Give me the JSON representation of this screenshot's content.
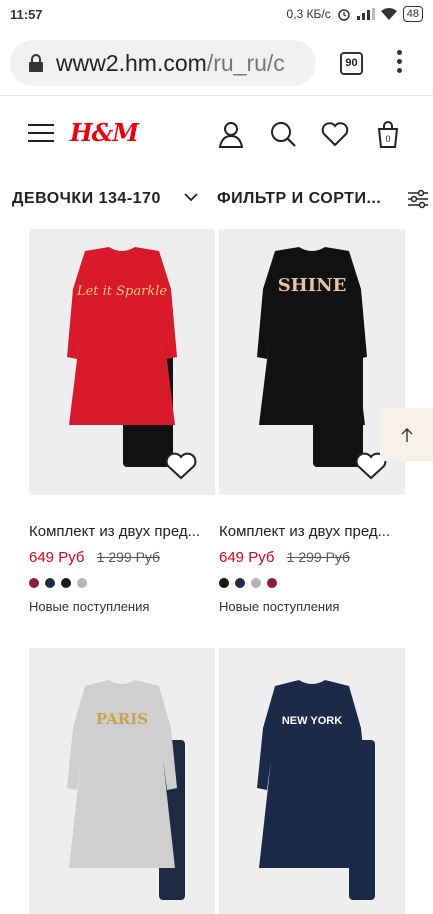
{
  "status_bar": {
    "time": "11:57",
    "net_speed": "0,3 КБ/с",
    "battery": "48"
  },
  "browser": {
    "url_host": "www2.hm.com",
    "url_path": "/ru_ru/c",
    "tab_count": "90"
  },
  "header": {
    "logo": "H&M"
  },
  "filters": {
    "category": "ДЕВОЧКИ 134-170",
    "filter_label": "ФИЛЬТР И СОРТИ..."
  },
  "products": [
    {
      "title": "Комплект из двух пред...",
      "price_new": "649 Руб",
      "price_old": "1 299 Руб",
      "swatches": [
        "#8b1e3f",
        "#1f2a44",
        "#1a1a1a",
        "#b5b5b5"
      ],
      "tag": "Новые поступления",
      "top_color": "#d81a2b",
      "top_text": "Let it Sparkle",
      "bottom_color": "#111111",
      "print_color": "#e8c77a"
    },
    {
      "title": "Комплект из двух пред...",
      "price_new": "649 Руб",
      "price_old": "1 299 Руб",
      "swatches": [
        "#1a1a1a",
        "#1f2a44",
        "#b5b5b5",
        "#8b1e3f"
      ],
      "tag": "Новые поступления",
      "top_color": "#111111",
      "top_text": "SHINE",
      "bottom_color": "#111111",
      "print_color": "#e6c2a3"
    },
    {
      "top_color": "#cfcfcf",
      "top_text": "PARIS",
      "bottom_color": "#1f2a44",
      "print_color": "#c9a44a"
    },
    {
      "top_color": "#1c2a4a",
      "top_text": "NEW YORK",
      "bottom_color": "#1c2a4a",
      "print_color": "#ffffff"
    }
  ],
  "colors": {
    "brand": "#e50010",
    "sale": "#d6001c",
    "image_bg": "#eeeeee",
    "back_to_top_bg": "#f7f1e7"
  }
}
